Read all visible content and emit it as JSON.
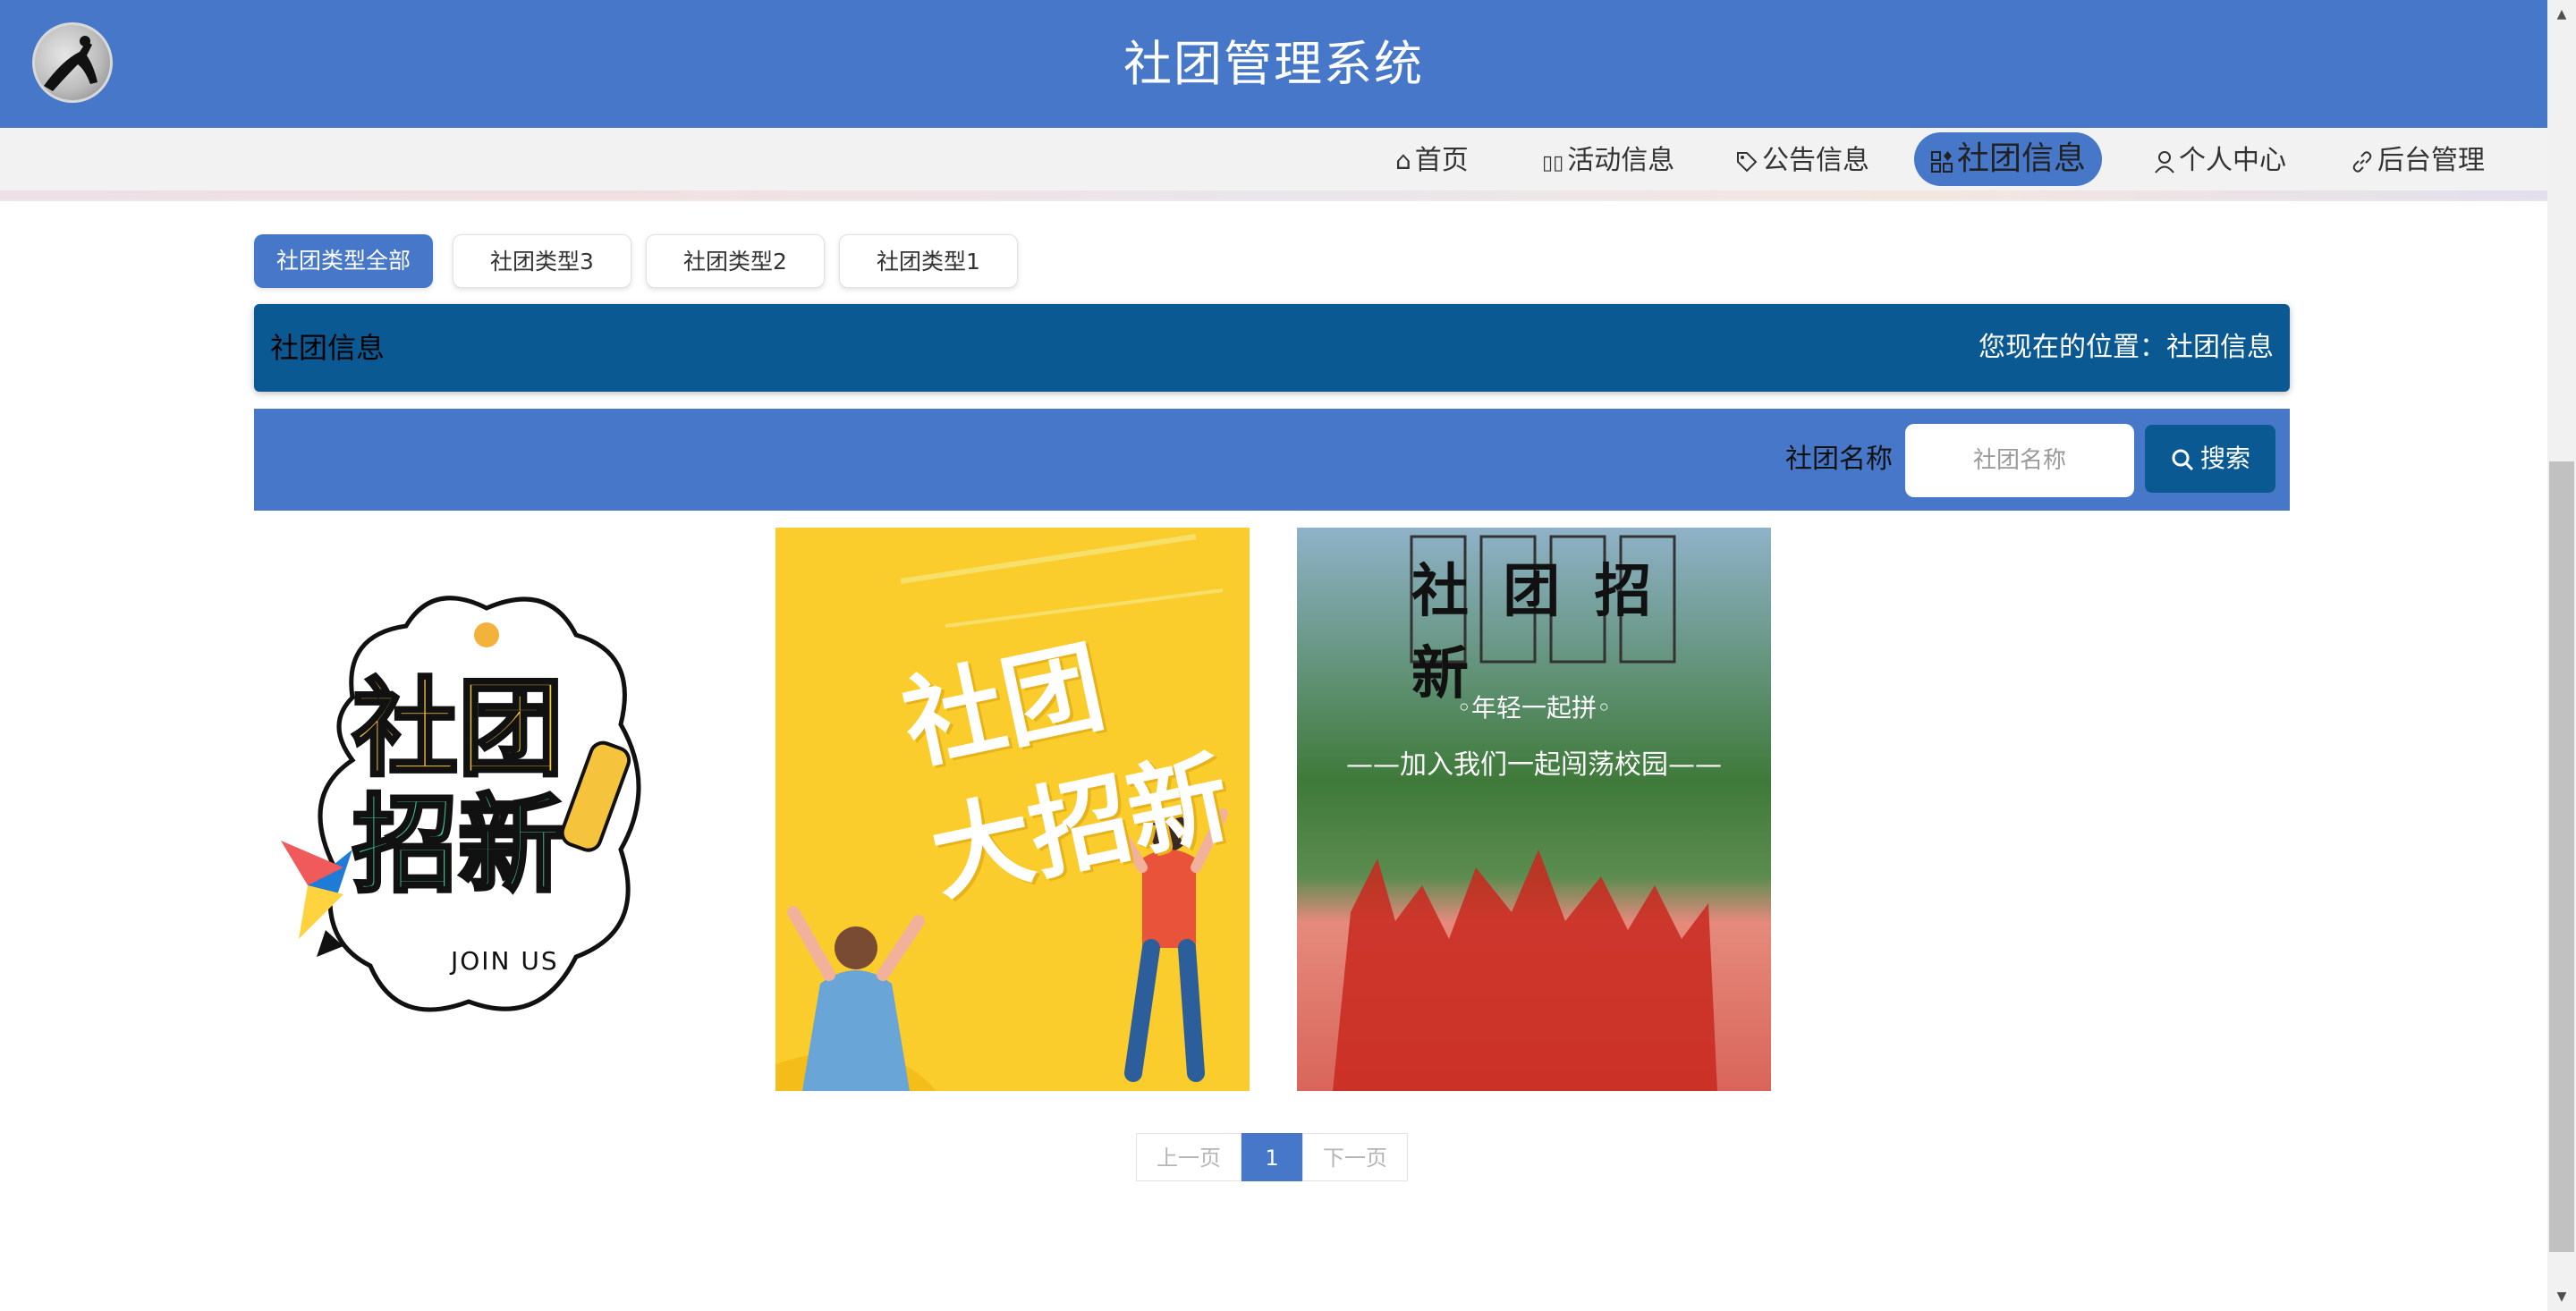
{
  "header": {
    "title": "社团管理系统"
  },
  "nav": {
    "items": [
      {
        "label": "首页",
        "icon": "home-icon"
      },
      {
        "label": "活动信息",
        "icon": "grid-icon"
      },
      {
        "label": "公告信息",
        "icon": "tag-icon"
      },
      {
        "label": "社团信息",
        "icon": "apps-icon",
        "active": true
      },
      {
        "label": "个人中心",
        "icon": "user-icon"
      },
      {
        "label": "后台管理",
        "icon": "link-icon"
      }
    ]
  },
  "categories": {
    "items": [
      "社团类型全部",
      "社团类型3",
      "社团类型2",
      "社团类型1"
    ],
    "selected": "社团类型全部"
  },
  "info": {
    "title": "社团信息",
    "location": "您现在的位置：社团信息"
  },
  "search": {
    "label": "社团名称",
    "placeholder": "社团名称",
    "value": "",
    "button": "搜索"
  },
  "cards": [
    {
      "text_line1": "社团",
      "text_line2": "招新",
      "sub": "JOIN US"
    },
    {
      "text_line1": "社团",
      "text_line2": "大招新"
    },
    {
      "title": "社 团 招 新",
      "slogan": "◦年轻一起拼◦",
      "sub": "——加入我们一起闯荡校园——"
    }
  ],
  "pagination": {
    "prev": "上一页",
    "current": "1",
    "next": "下一页"
  },
  "colors": {
    "primary": "#4677c8",
    "dark": "#0b5993"
  }
}
